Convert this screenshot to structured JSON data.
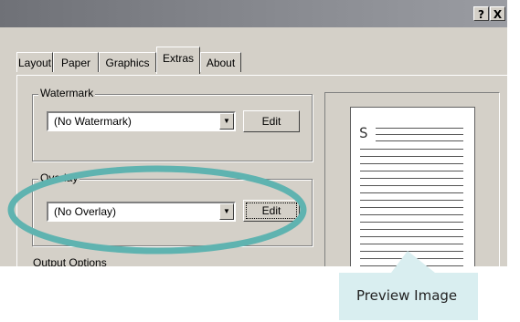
{
  "window": {
    "help_button": "?",
    "close_button": "X"
  },
  "tabs": [
    {
      "label": "Layout",
      "active": false
    },
    {
      "label": "Paper",
      "active": false
    },
    {
      "label": "Graphics",
      "active": false
    },
    {
      "label": "Extras",
      "active": true
    },
    {
      "label": "About",
      "active": false
    }
  ],
  "watermark": {
    "group_label": "Watermark",
    "selected": "(No Watermark)",
    "edit_label": "Edit"
  },
  "overlay": {
    "group_label": "Overlay",
    "selected": "(No Overlay)",
    "edit_label": "Edit",
    "highlight_color": "#5fb3b0"
  },
  "output_options": {
    "group_label": "Output Options"
  },
  "preview": {
    "page_letter": "S"
  },
  "callout": {
    "text": "Preview Image",
    "color": "#d9eef0"
  }
}
